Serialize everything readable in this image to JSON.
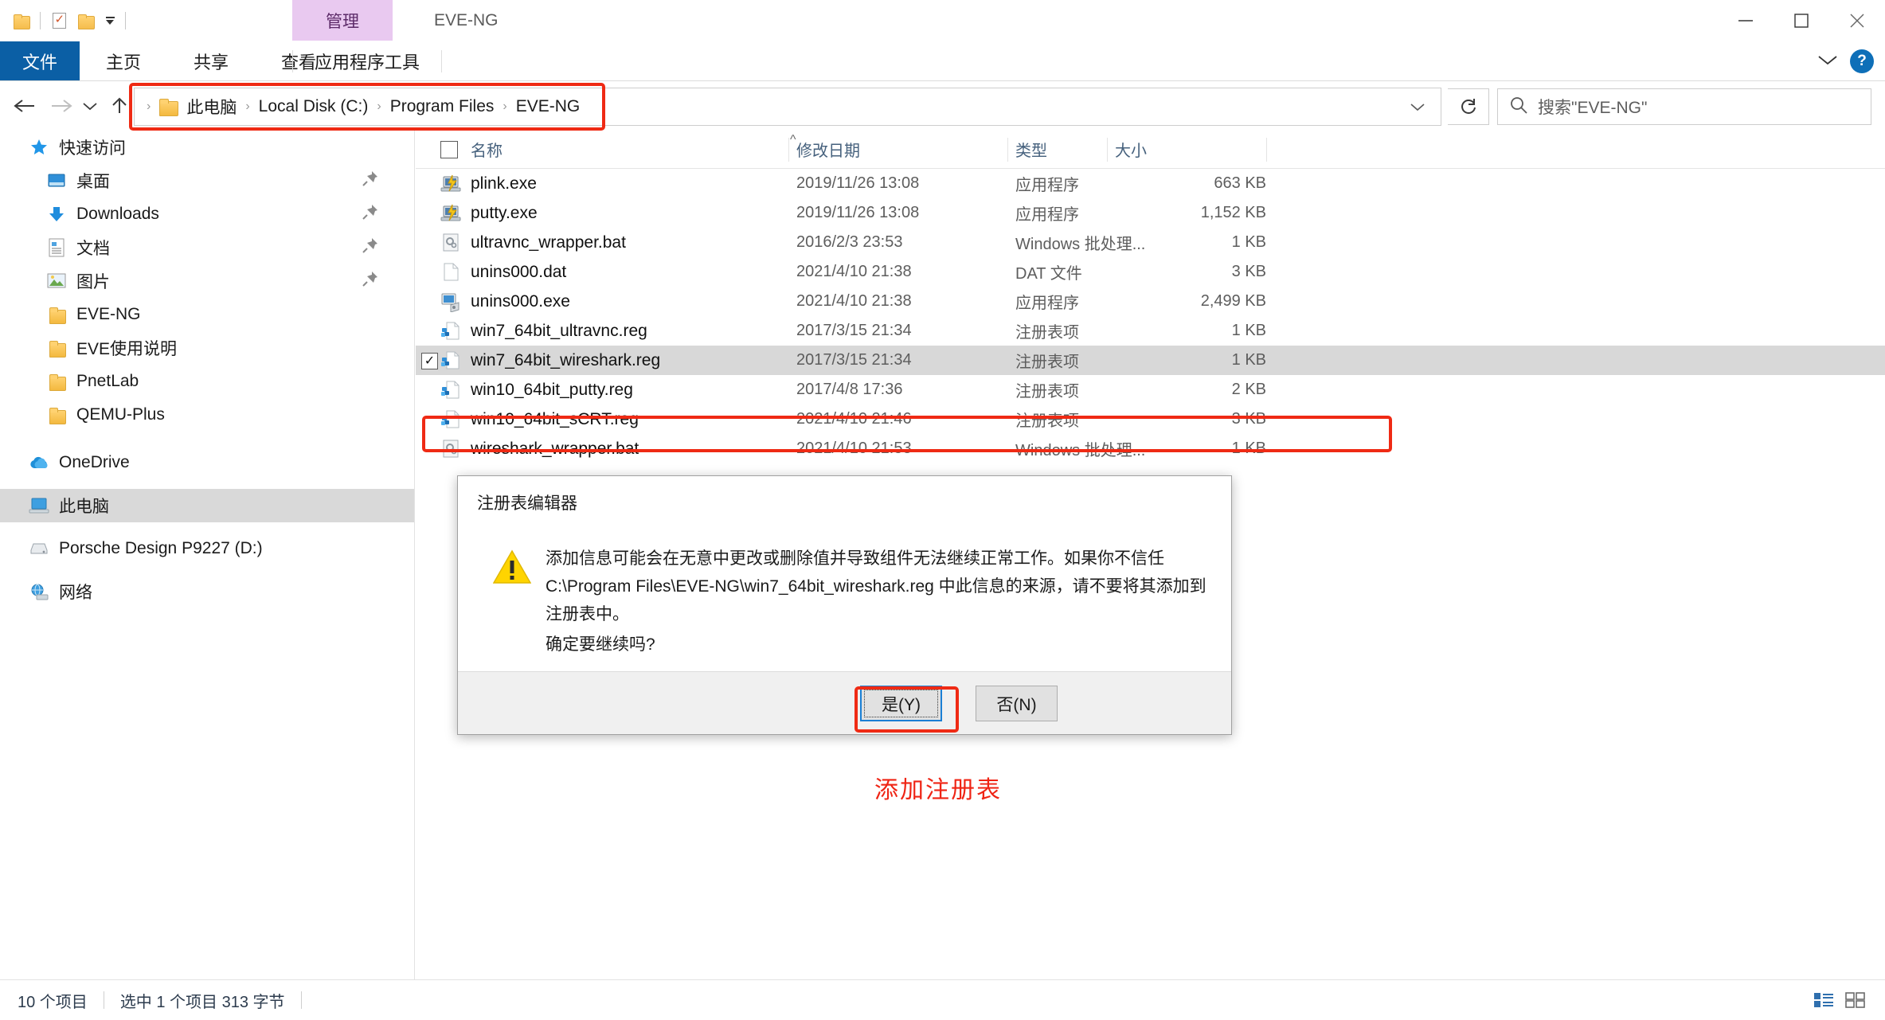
{
  "window": {
    "title": "EVE-NG",
    "contextual_tab": "管理",
    "minimize": "minimize-icon",
    "maximize": "maximize-icon",
    "close": "close-icon"
  },
  "ribbon": {
    "tabs": [
      {
        "label": "文件",
        "active": true
      },
      {
        "label": "主页",
        "active": false
      },
      {
        "label": "共享",
        "active": false
      },
      {
        "label": "查看",
        "active": false
      },
      {
        "label": "应用程序工具",
        "active": false
      }
    ],
    "help_label": "?"
  },
  "address": {
    "crumbs": [
      "此电脑",
      "Local Disk (C:)",
      "Program Files",
      "EVE-NG"
    ],
    "separator": "›",
    "refresh_label": "↻"
  },
  "search": {
    "placeholder": "搜索\"EVE-NG\"",
    "value": "搜索\"EVE-NG\""
  },
  "sidebar": {
    "groups": [
      {
        "header": "快速访问",
        "items": [
          {
            "label": "桌面",
            "icon": "desktop-icon",
            "pinned": true
          },
          {
            "label": "Downloads",
            "icon": "downloads-icon",
            "pinned": true
          },
          {
            "label": "文档",
            "icon": "documents-icon",
            "pinned": true
          },
          {
            "label": "图片",
            "icon": "pictures-icon",
            "pinned": true
          },
          {
            "label": "EVE-NG",
            "icon": "folder-icon",
            "pinned": false
          },
          {
            "label": "EVE使用说明",
            "icon": "folder-icon",
            "pinned": false
          },
          {
            "label": "PnetLab",
            "icon": "folder-icon",
            "pinned": false
          },
          {
            "label": "QEMU-Plus",
            "icon": "folder-icon",
            "pinned": false
          }
        ]
      },
      {
        "header": null,
        "items": [
          {
            "label": "OneDrive",
            "icon": "onedrive-icon",
            "pinned": false
          },
          {
            "label": "此电脑",
            "icon": "thispc-icon",
            "pinned": false,
            "selected": true
          },
          {
            "label": "Porsche Design P9227 (D:)",
            "icon": "drive-icon",
            "pinned": false
          },
          {
            "label": "网络",
            "icon": "network-icon",
            "pinned": false
          }
        ]
      }
    ]
  },
  "filelist": {
    "columns": [
      "名称",
      "修改日期",
      "类型",
      "大小"
    ],
    "rows": [
      {
        "name": "plink.exe",
        "date": "2019/11/26 13:08",
        "type": "应用程序",
        "size": "663 KB",
        "icon": "putty-exe-icon",
        "selected": false,
        "checked": false
      },
      {
        "name": "putty.exe",
        "date": "2019/11/26 13:08",
        "type": "应用程序",
        "size": "1,152 KB",
        "icon": "putty-exe-icon",
        "selected": false,
        "checked": false
      },
      {
        "name": "ultravnc_wrapper.bat",
        "date": "2016/2/3 23:53",
        "type": "Windows 批处理...",
        "size": "1 KB",
        "icon": "bat-file-icon",
        "selected": false,
        "checked": false
      },
      {
        "name": "unins000.dat",
        "date": "2021/4/10 21:38",
        "type": "DAT 文件",
        "size": "3 KB",
        "icon": "blank-file-icon",
        "selected": false,
        "checked": false
      },
      {
        "name": "unins000.exe",
        "date": "2021/4/10 21:38",
        "type": "应用程序",
        "size": "2,499 KB",
        "icon": "installer-icon",
        "selected": false,
        "checked": false
      },
      {
        "name": "win7_64bit_ultravnc.reg",
        "date": "2017/3/15 21:34",
        "type": "注册表项",
        "size": "1 KB",
        "icon": "reg-file-icon",
        "selected": false,
        "checked": false
      },
      {
        "name": "win7_64bit_wireshark.reg",
        "date": "2017/3/15 21:34",
        "type": "注册表项",
        "size": "1 KB",
        "icon": "reg-file-icon",
        "selected": true,
        "checked": true
      },
      {
        "name": "win10_64bit_putty.reg",
        "date": "2017/4/8 17:36",
        "type": "注册表项",
        "size": "2 KB",
        "icon": "reg-file-icon",
        "selected": false,
        "checked": false
      },
      {
        "name": "win10_64bit_sCRT.reg",
        "date": "2021/4/10 21:46",
        "type": "注册表项",
        "size": "3 KB",
        "icon": "reg-file-icon",
        "selected": false,
        "checked": false
      },
      {
        "name": "wireshark_wrapper.bat",
        "date": "2021/4/10 21:53",
        "type": "Windows 批处理...",
        "size": "1 KB",
        "icon": "bat-file-icon",
        "selected": false,
        "checked": false
      }
    ]
  },
  "annotation": {
    "text": "添加注册表",
    "color": "#ef2414"
  },
  "dialog": {
    "title": "注册表编辑器",
    "icon": "warning-icon",
    "message": "添加信息可能会在无意中更改或删除值并导致组件无法继续正常工作。如果你不信任 C:\\Program Files\\EVE-NG\\win7_64bit_wireshark.reg 中此信息的来源，请不要将其添加到注册表中。",
    "question": "确定要继续吗?",
    "buttons": [
      {
        "label": "是(Y)",
        "accel": "Y",
        "primary": true
      },
      {
        "label": "否(N)",
        "accel": "N",
        "primary": false
      }
    ]
  },
  "statusbar": {
    "item_count": "10 个项目",
    "selection": "选中 1 个项目  313 字节",
    "view_details": "details-view-icon",
    "view_large": "large-icons-view-icon"
  },
  "colors": {
    "accent": "#0b5fa5",
    "highlight_red": "#ef2a14",
    "selection_gray": "#d8d8d8",
    "contextual_tab": "#e9c9f0"
  }
}
